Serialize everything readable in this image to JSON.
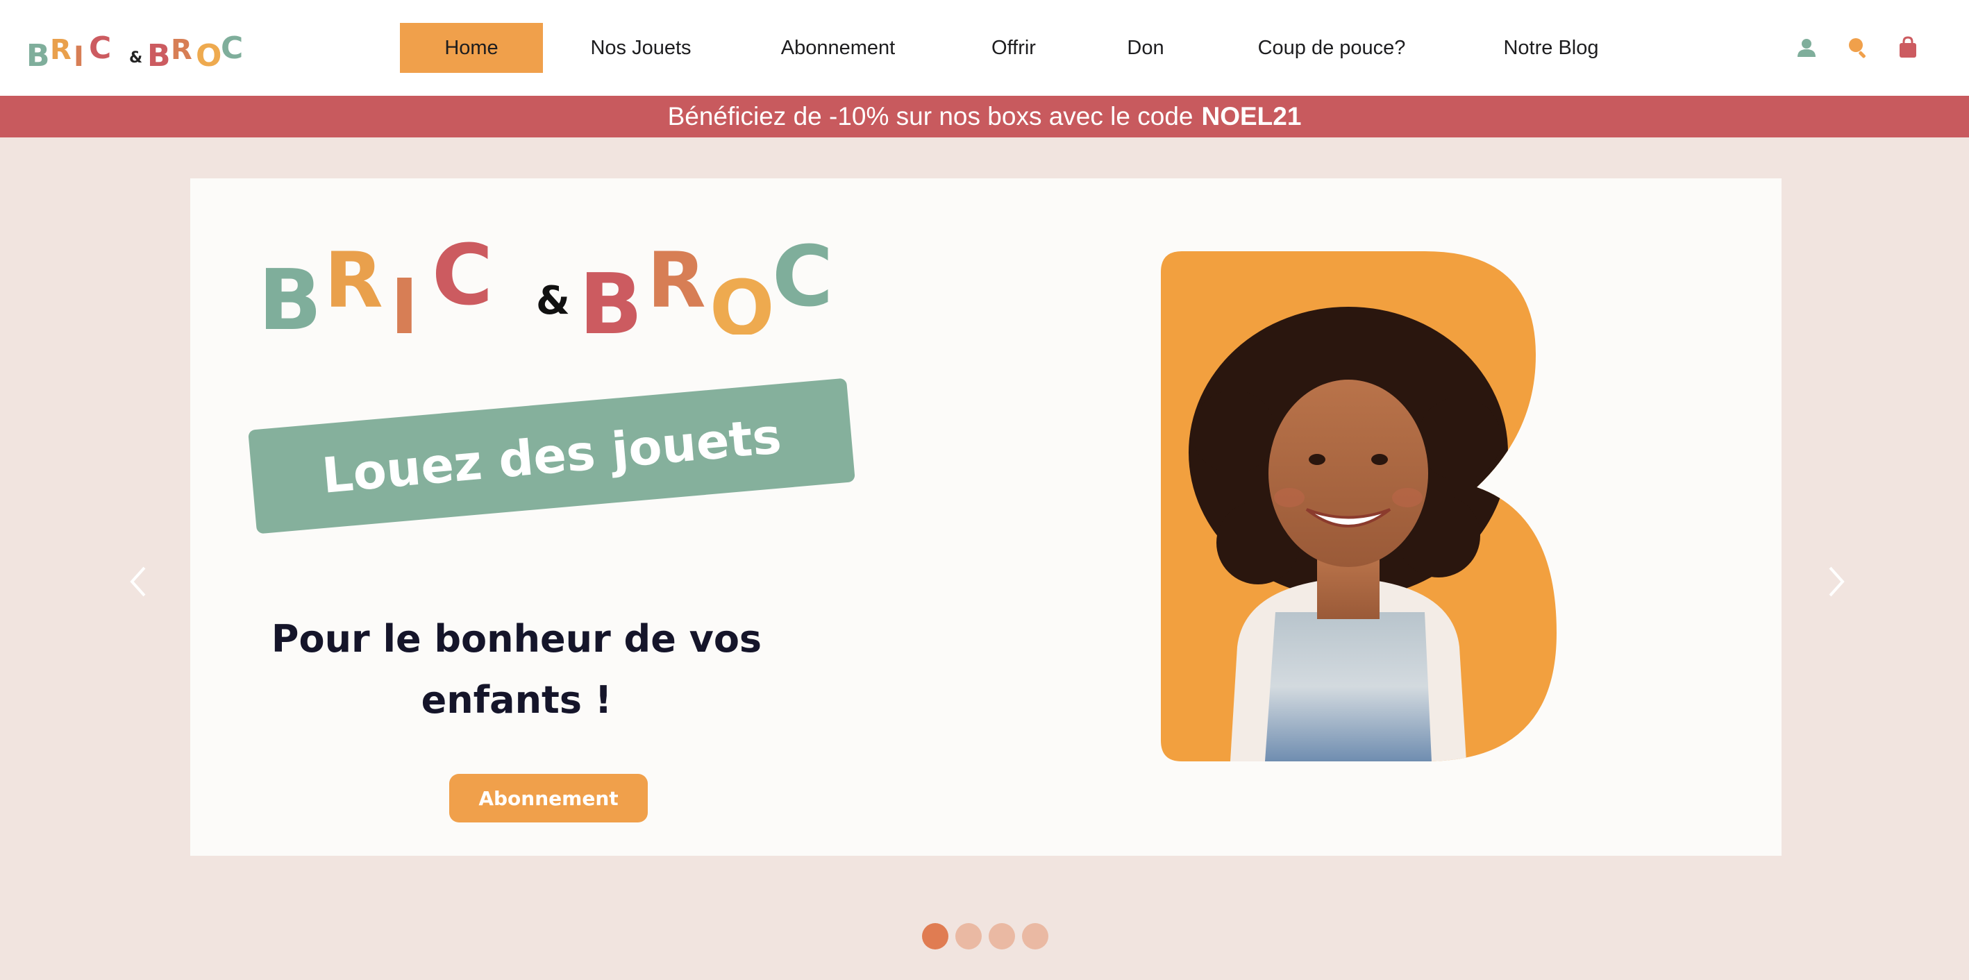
{
  "brand": {
    "letters_left": [
      "B",
      "R",
      "I",
      "C"
    ],
    "ampersand": "&",
    "letters_right": [
      "B",
      "R",
      "O",
      "C"
    ],
    "letter_colors": [
      "#7fae9b",
      "#e9a04c",
      "#d77e55",
      "#cc5b60",
      "#cc5b60",
      "#d77e55",
      "#eeaa4f",
      "#7fae9b"
    ]
  },
  "nav": {
    "items": [
      {
        "label": "Home",
        "active": true
      },
      {
        "label": "Nos Jouets",
        "active": false
      },
      {
        "label": "Abonnement",
        "active": false
      },
      {
        "label": "Offrir",
        "active": false
      },
      {
        "label": "Don",
        "active": false
      },
      {
        "label": "Coup de pouce?",
        "active": false
      },
      {
        "label": "Notre Blog",
        "active": false
      }
    ],
    "icons": [
      "user-icon",
      "search-icon",
      "bag-icon"
    ]
  },
  "promo": {
    "text": "Bénéficiez de -10% sur nos boxs avec le code",
    "code": "NOEL21",
    "color": "#c85a5e"
  },
  "hero": {
    "ribbon_text": "Louez des jouets",
    "headline_line1": "Pour le bonheur de vos",
    "headline_line2": "enfants !",
    "cta_label": "Abonnement",
    "accent": "#f0a04b",
    "ribbon_color": "#85b09c"
  },
  "carousel": {
    "slides": 4,
    "active_slide": 1
  }
}
